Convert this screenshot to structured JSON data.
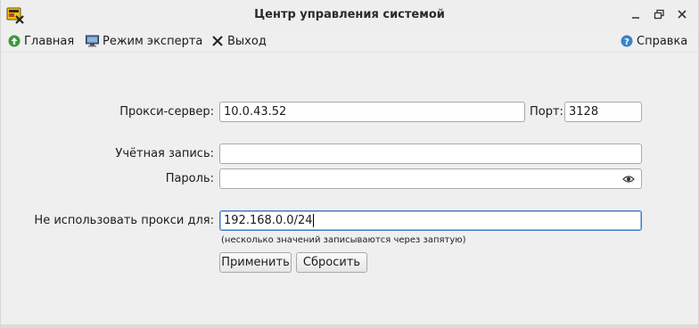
{
  "window": {
    "title": "Центр управления системой"
  },
  "menu": {
    "home_label": "Главная",
    "expert_label": "Режим эксперта",
    "exit_label": "Выход",
    "help_label": "Справка"
  },
  "form": {
    "proxy_label": "Прокси-сервер:",
    "proxy_value": "10.0.43.52",
    "port_label": "Порт:",
    "port_value": "3128",
    "account_label": "Учётная запись:",
    "account_value": "",
    "password_label": "Пароль:",
    "password_value": "",
    "noproxy_label": "Не использовать прокси для:",
    "noproxy_value": "192.168.0.0/24",
    "hint": "(несколько значений записываются через запятую)",
    "apply_label": "Применить",
    "reset_label": "Сбросить"
  },
  "colors": {
    "home_icon": "#3a9a3a",
    "help_icon": "#3b82c8",
    "focus_border": "#3f7ac4"
  },
  "icons": {
    "home": "home-arrow-icon",
    "expert": "monitor-icon",
    "exit": "close-x-icon",
    "help": "help-icon",
    "password_reveal": "eye-icon"
  }
}
